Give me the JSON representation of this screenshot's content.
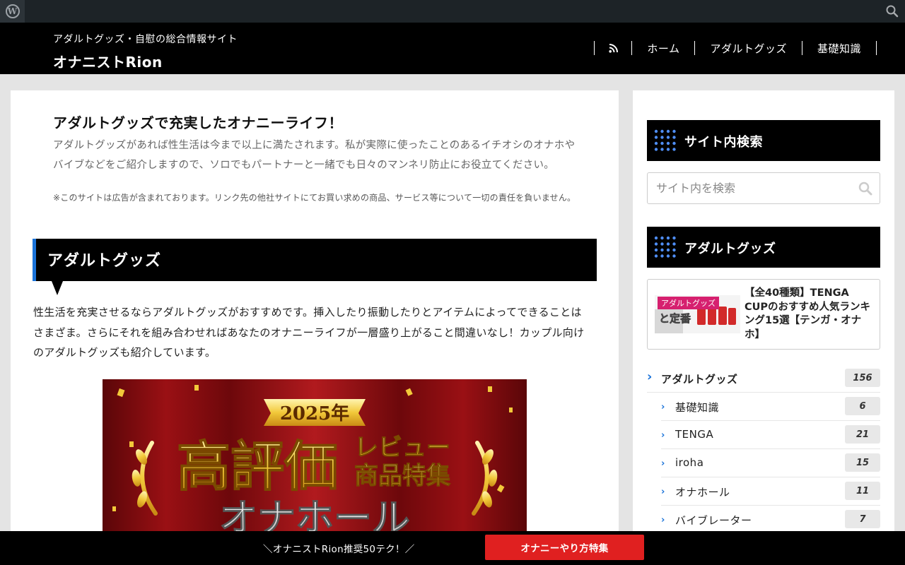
{
  "adminbar": {
    "logo_letter": "W"
  },
  "header": {
    "tagline": "アダルトグッズ・自慰の総合情報サイト",
    "title": "オナニストRion",
    "nav": [
      "ホーム",
      "アダルトグッズ",
      "基礎知識"
    ]
  },
  "intro": {
    "title": "アダルトグッズで充実したオナニーライフ！",
    "text": "アダルトグッズがあれば性生活は今まで以上に満たされます。私が実際に使ったことのあるイチオシのオナホやバイブなどをご紹介しますので、ソロでもパートナーと一緒でも日々のマンネリ防止にお役立てください。",
    "note": "※このサイトは広告が含まれております。リンク先の他社サイトにてお買い求めの商品、サービス等について一切の責任を負いません。"
  },
  "section": {
    "heading": "アダルトグッズ",
    "text": "性生活を充実させるならアダルトグッズがおすすめです。挿入したり振動したりとアイテムによってできることはさまざま。さらにそれを組み合わせればあなたのオナニーライフが一層盛り上がること間違いなし！カップル向けのアダルトグッズも紹介しています。"
  },
  "banner": {
    "year": "2025年",
    "main": "高評価",
    "sub1": "レビュー",
    "sub2": "商品特集",
    "bottom": "オナホール"
  },
  "sidebar": {
    "search_heading": "サイト内検索",
    "search_placeholder": "サイト内を検索",
    "goods_heading": "アダルトグッズ",
    "post": {
      "badge": "アダルトグッズ",
      "thumb_text": "と定番",
      "title": "【全40種類】TENGA CUPのおすすめ人気ランキング15選【テンガ・オナホ】"
    },
    "categories": [
      {
        "label": "アダルトグッズ",
        "count": "156"
      },
      {
        "label": "基礎知識",
        "count": "6"
      },
      {
        "label": "TENGA",
        "count": "21"
      },
      {
        "label": "iroha",
        "count": "15"
      },
      {
        "label": "オナホール",
        "count": "11"
      },
      {
        "label": "バイブレーター",
        "count": "7"
      }
    ]
  },
  "footer_bar": {
    "text": "＼オナニストRion推奨50テク！／",
    "button": "オナニーやり方特集"
  },
  "colors": {
    "accent": "#1a73d9",
    "cta": "#e02020",
    "header": "#000000"
  }
}
